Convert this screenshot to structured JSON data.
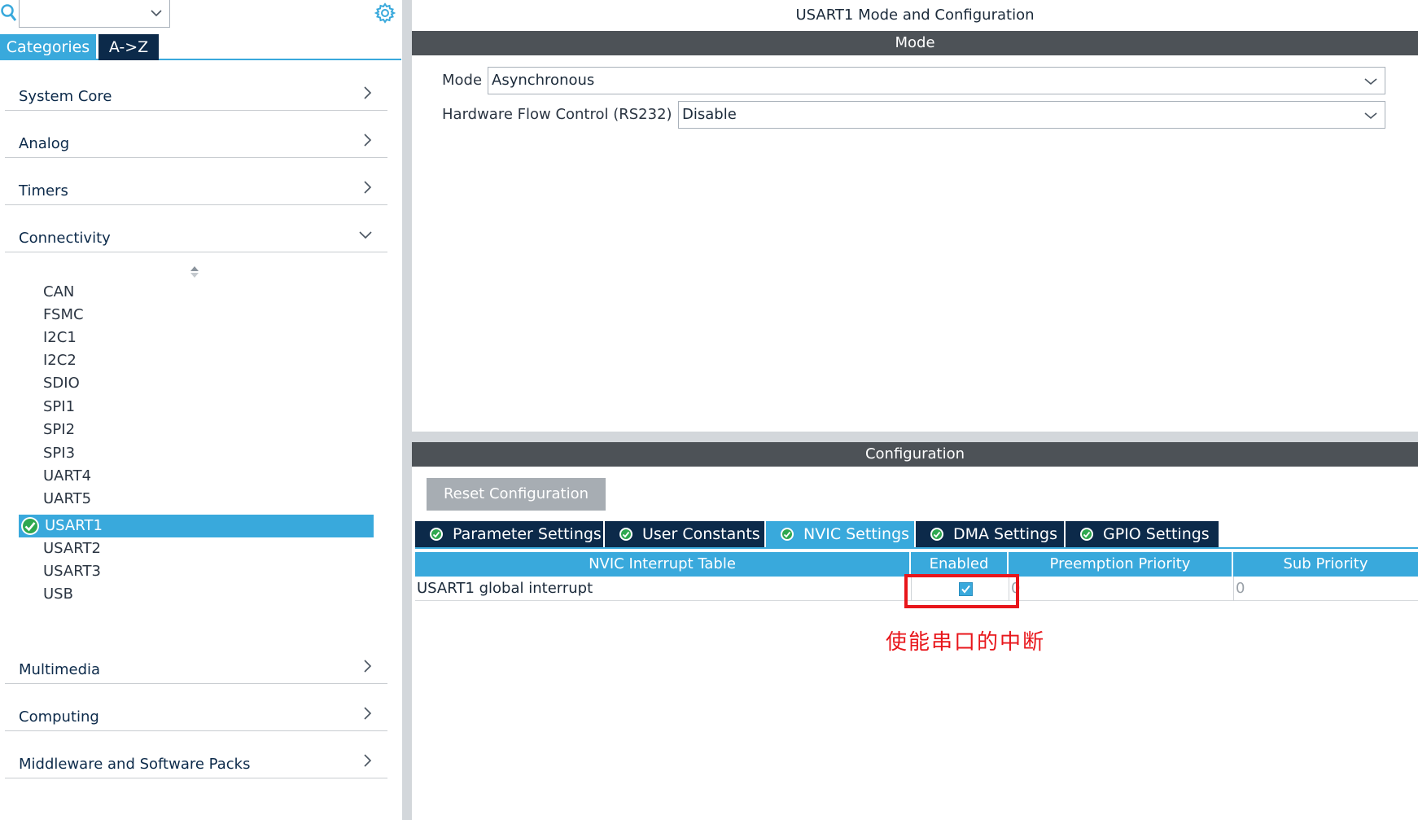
{
  "left": {
    "search": {
      "value": ""
    },
    "tabs": {
      "categories": "Categories",
      "az": "A->Z"
    },
    "categories": [
      {
        "label": "System Core"
      },
      {
        "label": "Analog"
      },
      {
        "label": "Timers"
      },
      {
        "label": "Connectivity"
      },
      {
        "label": "Multimedia"
      },
      {
        "label": "Computing"
      },
      {
        "label": "Middleware and Software Packs"
      }
    ],
    "connectivity_items": [
      "CAN",
      "FSMC",
      "I2C1",
      "I2C2",
      "SDIO",
      "SPI1",
      "SPI2",
      "SPI3",
      "UART4",
      "UART5",
      "USART1",
      "USART2",
      "USART3",
      "USB"
    ],
    "selected_item": "USART1"
  },
  "right": {
    "title": "USART1 Mode and Configuration",
    "mode_section": "Mode",
    "mode_label": "Mode",
    "mode_value": "Asynchronous",
    "flow_label": "Hardware Flow Control (RS232)",
    "flow_value": "Disable",
    "config_section": "Configuration",
    "reset_button": "Reset Configuration",
    "tabs": [
      {
        "label": "Parameter Settings",
        "active": false
      },
      {
        "label": "User Constants",
        "active": false
      },
      {
        "label": "NVIC Settings",
        "active": true
      },
      {
        "label": "DMA Settings",
        "active": false
      },
      {
        "label": "GPIO Settings",
        "active": false
      }
    ],
    "table": {
      "headers": [
        "NVIC Interrupt Table",
        "Enabled",
        "Preemption Priority",
        "Sub Priority"
      ],
      "rows": [
        {
          "name": "USART1 global interrupt",
          "enabled": true,
          "preemption": "0",
          "sub": "0"
        }
      ]
    },
    "annotation": "使能串口的中断"
  },
  "colors": {
    "accent": "#39a9dc",
    "navy": "#0c2a4a",
    "section_bar": "#4d5257",
    "highlight": "#e8161b"
  }
}
